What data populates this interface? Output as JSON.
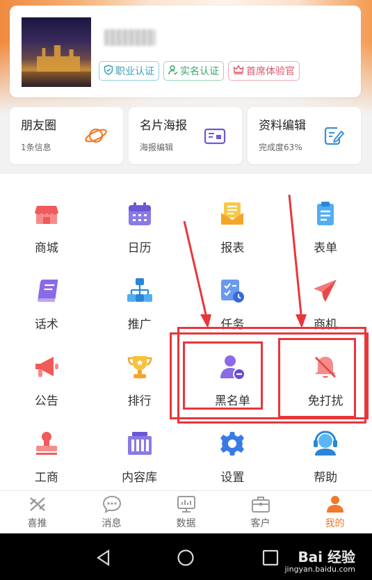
{
  "profile": {
    "badges": [
      {
        "label": "职业认证",
        "icon": "shield-check-icon"
      },
      {
        "label": "实名认证",
        "icon": "person-check-icon"
      },
      {
        "label": "首席体验官",
        "icon": "crown-icon"
      }
    ]
  },
  "quick": [
    {
      "title": "朋友圈",
      "sub": "1条信息",
      "icon": "planet-icon"
    },
    {
      "title": "名片海报",
      "sub": "海报编辑",
      "icon": "poster-icon"
    },
    {
      "title": "资料编辑",
      "sub": "完成度63%",
      "icon": "edit-doc-icon"
    }
  ],
  "grid": [
    [
      {
        "label": "商城",
        "icon": "store-icon"
      },
      {
        "label": "日历",
        "icon": "calendar-icon"
      },
      {
        "label": "报表",
        "icon": "report-icon"
      },
      {
        "label": "表单",
        "icon": "clipboard-icon"
      }
    ],
    [
      {
        "label": "话术",
        "icon": "book-icon"
      },
      {
        "label": "推广",
        "icon": "org-chart-icon"
      },
      {
        "label": "任务",
        "icon": "task-icon"
      },
      {
        "label": "商机",
        "icon": "paper-plane-icon"
      }
    ],
    [
      {
        "label": "公告",
        "icon": "megaphone-icon"
      },
      {
        "label": "排行",
        "icon": "trophy-icon"
      },
      {
        "label": "黑名单",
        "icon": "user-block-icon"
      },
      {
        "label": "免打扰",
        "icon": "bell-off-icon"
      }
    ],
    [
      {
        "label": "工商",
        "icon": "stamp-icon"
      },
      {
        "label": "内容库",
        "icon": "library-icon"
      },
      {
        "label": "设置",
        "icon": "gear-icon"
      },
      {
        "label": "帮助",
        "icon": "headset-icon"
      }
    ]
  ],
  "nav": [
    {
      "label": "喜推",
      "icon": "xitui-icon",
      "active": false
    },
    {
      "label": "消息",
      "icon": "chat-bubble-icon",
      "active": false
    },
    {
      "label": "数据",
      "icon": "monitor-chart-icon",
      "active": false
    },
    {
      "label": "客户",
      "icon": "briefcase-icon",
      "active": false
    },
    {
      "label": "我的",
      "icon": "person-icon",
      "active": true
    }
  ],
  "watermark": {
    "brand": "Bai 经验",
    "url": "jingyan.baidu.com"
  },
  "colors": {
    "accent": "#f07a2a",
    "annotation": "#e8363a"
  }
}
